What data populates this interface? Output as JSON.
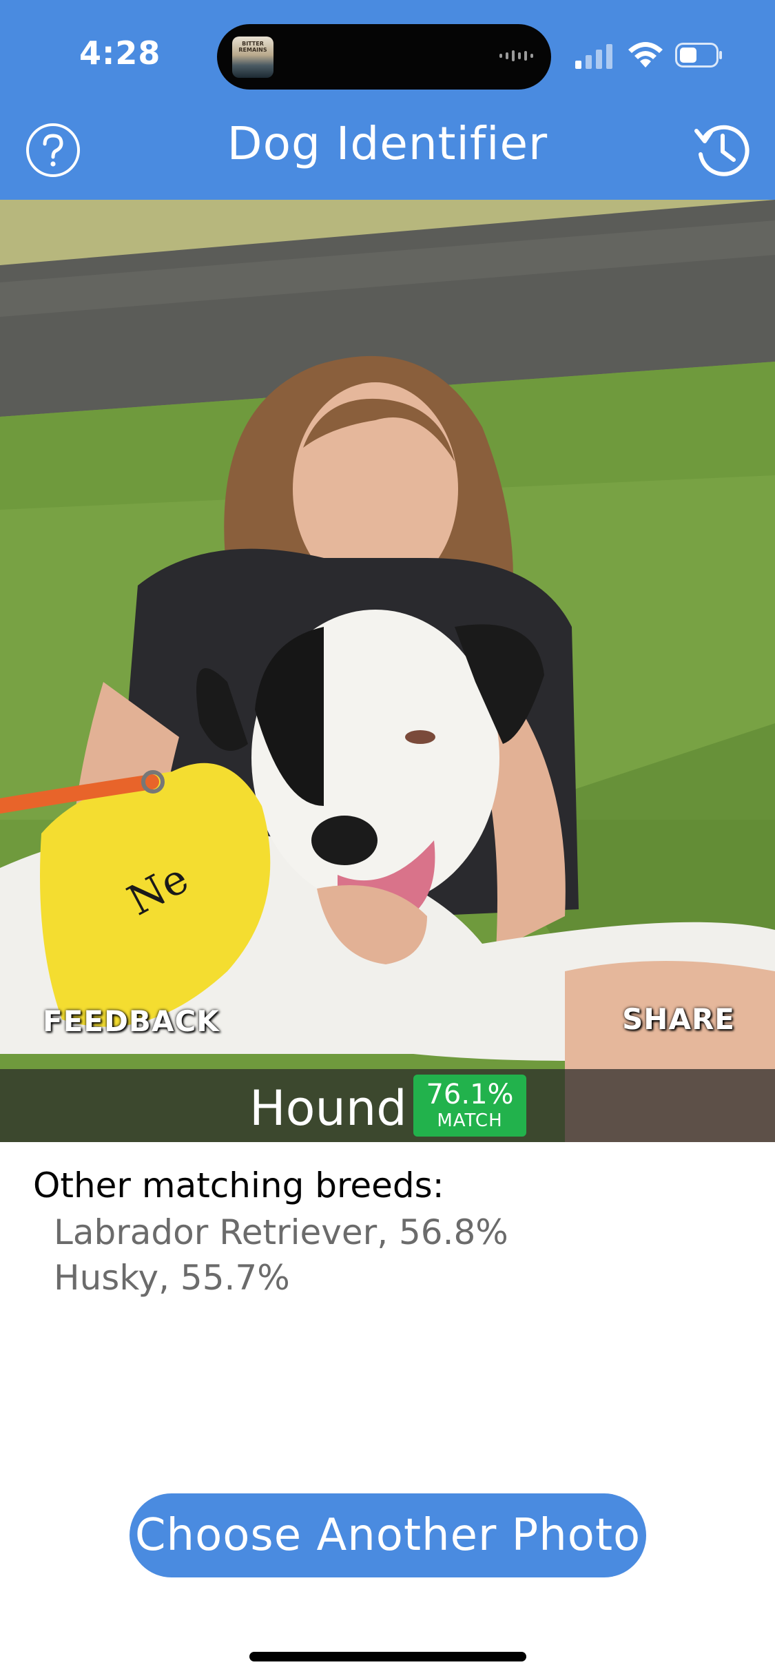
{
  "status_bar": {
    "time": "4:28",
    "now_playing_art_text": "BITTER REMAINS"
  },
  "nav": {
    "title": "Dog Identifier",
    "help_icon": "question-circle-icon",
    "history_icon": "history-clock-icon"
  },
  "photo": {
    "feedback_label": "FEEDBACK",
    "share_label": "SHARE"
  },
  "result": {
    "breed": "Hound",
    "match_percent": "76.1%",
    "match_label": "MATCH"
  },
  "other_breeds": {
    "heading": "Other matching breeds:",
    "items": [
      "Labrador Retriever, 56.8%",
      "Husky, 55.7%"
    ]
  },
  "actions": {
    "choose_another": "Choose Another Photo"
  },
  "colors": {
    "brand_blue": "#4a8be0",
    "match_green": "#22b24c"
  }
}
